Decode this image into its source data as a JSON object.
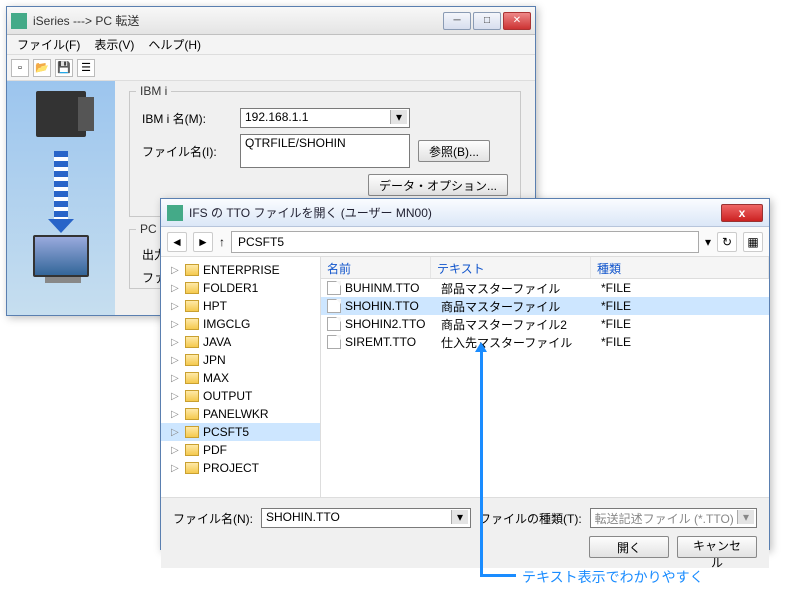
{
  "parent": {
    "title": "iSeries ---> PC 転送",
    "menu": {
      "file": "ファイル(F)",
      "view": "表示(V)",
      "help": "ヘルプ(H)"
    },
    "group_ibmi": {
      "legend": "IBM i",
      "name_label": "IBM i 名(M):",
      "name_value": "192.168.1.1",
      "file_label": "ファイル名(I):",
      "file_value": "QTRFILE/SHOHIN",
      "browse_btn": "参照(B)...",
      "dataopt_btn": "データ・オプション..."
    },
    "group_pc": {
      "legend": "PC",
      "out_label": "出力装置",
      "file_label": "ファイル"
    }
  },
  "dialog": {
    "title": "IFS の TTO ファイルを開く (ユーザー MN00)",
    "path": "PCSFT5",
    "tree": [
      "ENTERPRISE",
      "FOLDER1",
      "HPT",
      "IMGCLG",
      "JAVA",
      "JPN",
      "MAX",
      "OUTPUT",
      "PANELWKR",
      "PCSFT5",
      "PDF",
      "PROJECT"
    ],
    "tree_selected": "PCSFT5",
    "cols": {
      "name": "名前",
      "text": "テキスト",
      "kind": "種類"
    },
    "files": [
      {
        "name": "BUHINM.TTO",
        "text": "部品マスターファイル",
        "kind": "*FILE"
      },
      {
        "name": "SHOHIN.TTO",
        "text": "商品マスターファイル",
        "kind": "*FILE"
      },
      {
        "name": "SHOHIN2.TTO",
        "text": "商品マスターファイル2",
        "kind": "*FILE"
      },
      {
        "name": "SIREMT.TTO",
        "text": "仕入先マスターファイル",
        "kind": "*FILE"
      }
    ],
    "file_selected": "SHOHIN.TTO",
    "fname_label": "ファイル名(N):",
    "fname_value": "SHOHIN.TTO",
    "ftype_label": "ファイルの種類(T):",
    "ftype_value": "転送記述ファイル (*.TTO)",
    "open_btn": "開く",
    "cancel_btn": "キャンセル"
  },
  "annotation": "テキスト表示でわかりやすく"
}
